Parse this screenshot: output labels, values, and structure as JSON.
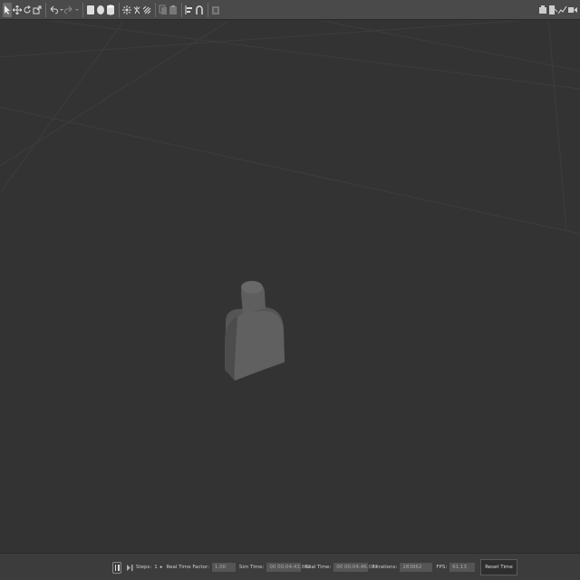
{
  "toolbar": {
    "left_tools": [
      "select-arrow-icon",
      "translate-icon",
      "rotate-icon",
      "scale-icon",
      "undo-icon",
      "undo-dropdown-icon",
      "redo-icon",
      "redo-dropdown-icon",
      "box-shape-icon",
      "sphere-shape-icon",
      "cylinder-shape-icon",
      "point-light-icon",
      "spot-light-icon",
      "directional-light-icon",
      "copy-icon",
      "paste-icon",
      "align-icon",
      "snap-icon",
      "screenshot-icon"
    ],
    "right_tools": [
      "log-icon",
      "record-icon",
      "plot-icon",
      "video-record-icon"
    ]
  },
  "status": {
    "steps_label": "Steps:",
    "steps_value": "1",
    "rtf_label": "Real Time Factor:",
    "rtf_value": "1.00",
    "sim_time_label": "Sim Time:",
    "sim_time_value": "00 00:04:43.862",
    "real_time_label": "Real Time:",
    "real_time_value": "00 00:04:46.077",
    "iterations_label": "Iterations:",
    "iterations_value": "283862",
    "fps_label": "FPS:",
    "fps_value": "61.13",
    "reset_label": "Reset Time"
  }
}
